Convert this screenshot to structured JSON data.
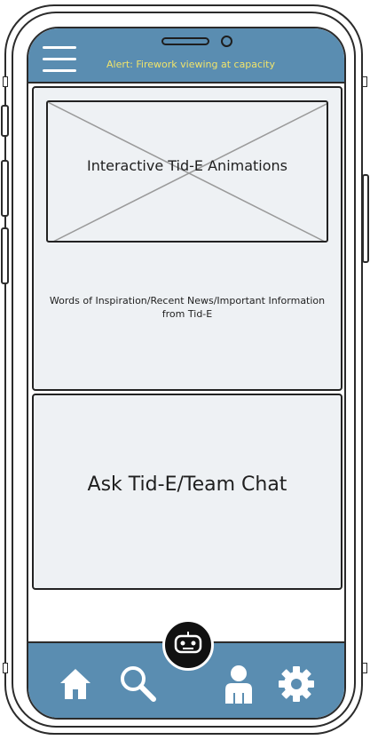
{
  "header": {
    "alert_text": "Alert: Firework viewing at capacity"
  },
  "main": {
    "animation_title": "Interactive Tid-E Animations",
    "inspiration_text": "Words of Inspiration/Recent News/Important Information from Tid-E",
    "chat_title": "Ask Tid-E/Team Chat"
  },
  "nav": {
    "items": [
      "home",
      "search",
      "tid-e-chat",
      "profile",
      "settings"
    ]
  },
  "colors": {
    "bar": "#5a8db1",
    "alert": "#f1e46b",
    "panel": "#eef1f4"
  }
}
